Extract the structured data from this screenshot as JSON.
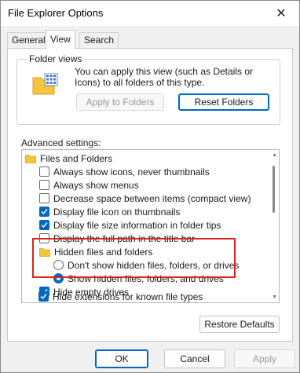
{
  "window": {
    "title": "File Explorer Options"
  },
  "tabs": [
    {
      "label": "General"
    },
    {
      "label": "View"
    },
    {
      "label": "Search"
    }
  ],
  "folder_views": {
    "group_label": "Folder views",
    "description": "You can apply this view (such as Details or Icons) to all folders of this type.",
    "apply_label": "Apply to Folders",
    "reset_label": "Reset Folders"
  },
  "advanced": {
    "label": "Advanced settings:",
    "items": [
      {
        "type": "folder",
        "label": "Files and Folders"
      },
      {
        "type": "checkbox",
        "checked": false,
        "label": "Always show icons, never thumbnails"
      },
      {
        "type": "checkbox",
        "checked": false,
        "label": "Always show menus"
      },
      {
        "type": "checkbox",
        "checked": false,
        "label": "Decrease space between items (compact view)"
      },
      {
        "type": "checkbox",
        "checked": true,
        "label": "Display file icon on thumbnails"
      },
      {
        "type": "checkbox",
        "checked": true,
        "label": "Display file size information in folder tips"
      },
      {
        "type": "checkbox",
        "checked": false,
        "label": "Display the full path in the title bar"
      },
      {
        "type": "folder",
        "label": "Hidden files and folders"
      },
      {
        "type": "radio",
        "checked": false,
        "label": "Don't show hidden files, folders, or drives"
      },
      {
        "type": "radio",
        "checked": true,
        "label": "Show hidden files, folders, and drives"
      },
      {
        "type": "checkbox",
        "checked": true,
        "label": "Hide empty drives"
      },
      {
        "type": "checkbox",
        "checked": true,
        "label": "Hide extensions for known file types"
      }
    ]
  },
  "buttons": {
    "restore_defaults": "Restore Defaults",
    "ok": "OK",
    "cancel": "Cancel",
    "apply": "Apply"
  },
  "icons": {
    "close": "close-icon",
    "folder": "folder-icon",
    "checkmark": "checkmark-icon"
  },
  "colors": {
    "accent": "#0067c0",
    "highlight_box": "#d9231f",
    "folder_yellow": "#f5c342"
  }
}
